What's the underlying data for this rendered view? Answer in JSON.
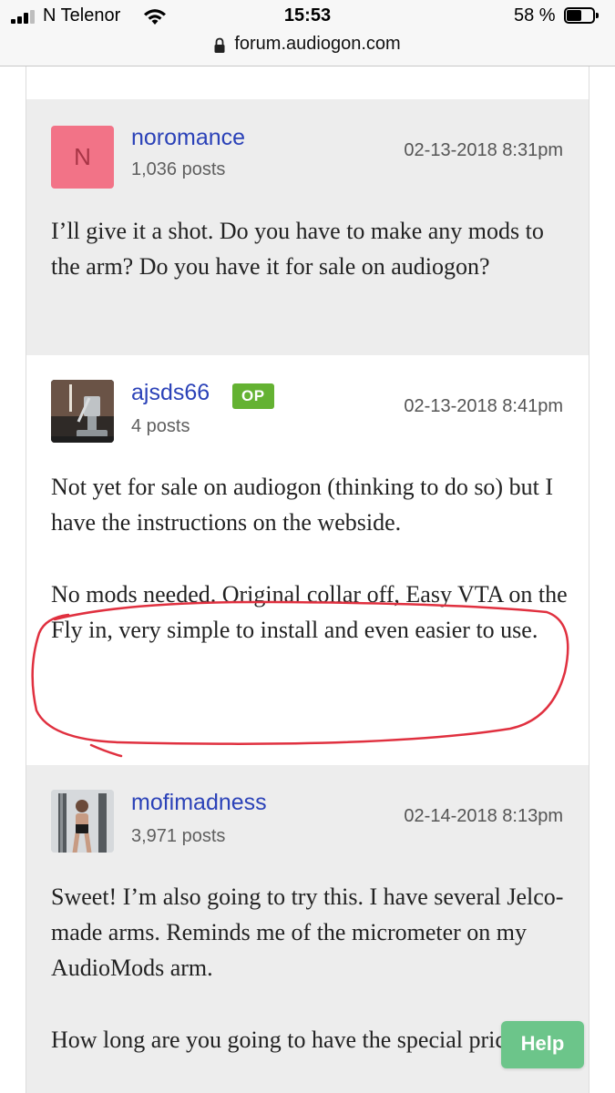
{
  "status_bar": {
    "carrier": "N Telenor",
    "time": "15:53",
    "battery_percent": "58 %",
    "battery_level": 0.58,
    "signal_icon": "cellular-signal-icon",
    "wifi_icon": "wifi-icon",
    "battery_icon": "battery-icon"
  },
  "url_bar": {
    "domain": "forum.audiogon.com",
    "lock_icon": "lock-icon"
  },
  "posts": [
    {
      "username": "noromance",
      "avatar_letter": "N",
      "avatar_color": "#f27387",
      "post_count": "1,036 posts",
      "timestamp": "02-13-2018 8:31pm",
      "paragraphs": [
        "I’ll give it a shot. Do you have to make any mods to the arm? Do you have it for sale on audiogon?"
      ]
    },
    {
      "username": "ajsds66",
      "badge": "OP",
      "badge_color": "#64b232",
      "post_count": "4 posts",
      "timestamp": "02-13-2018 8:41pm",
      "paragraphs": [
        "Not yet for sale on audiogon (thinking to do so) but I have the instructions on the webside.",
        "No mods needed. Original collar off, Easy VTA on the Fly in, very simple to install and even easier to use."
      ]
    },
    {
      "username": "mofimadness",
      "post_count": "3,971 posts",
      "timestamp": "02-14-2018 8:13pm",
      "paragraphs": [
        "Sweet! I’m also going to try this. I have several Jelco-made arms. Reminds me of the micrometer on my AudioMods arm.",
        "How long are you going to have the special price?"
      ]
    }
  ],
  "help_button": {
    "label": "Help",
    "color": "#6cc58a"
  },
  "annotation_color": "#e0303f"
}
